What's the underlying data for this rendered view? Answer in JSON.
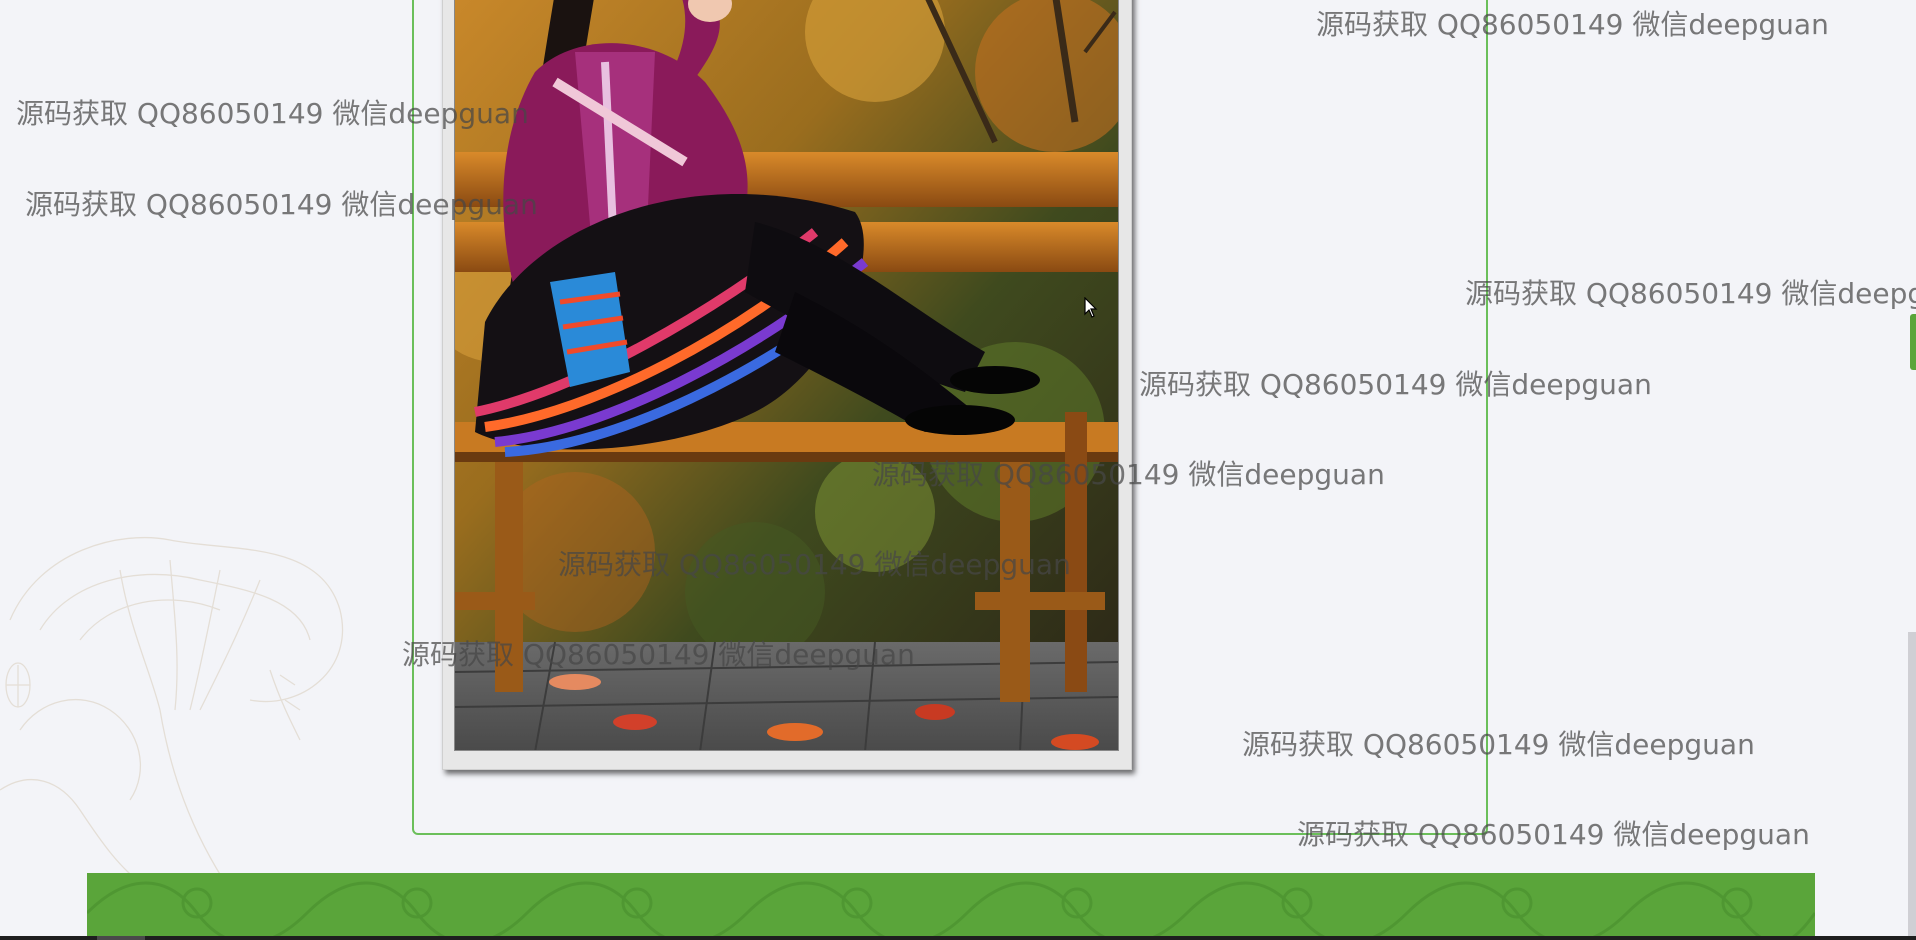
{
  "watermark_text": "源码获取 QQ86050149 微信deepguan",
  "colors": {
    "background": "#f3f4f8",
    "panel_border": "#6bbf5a",
    "footer_green": "#5aa53a"
  },
  "icons": {
    "cursor": "mouse-pointer-icon",
    "decoration": "lotus-decoration-icon"
  }
}
